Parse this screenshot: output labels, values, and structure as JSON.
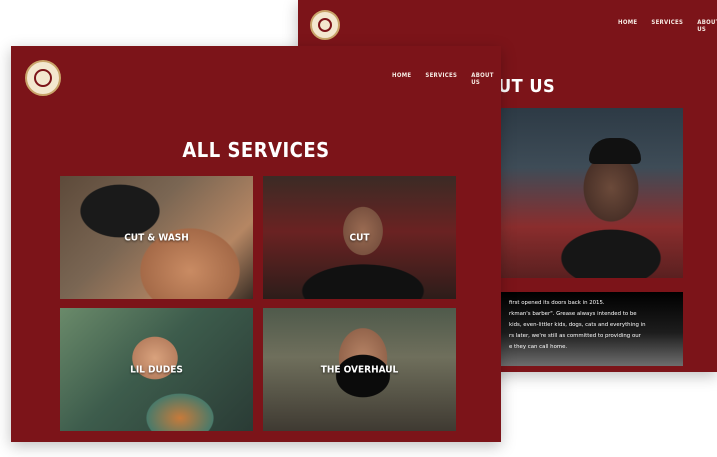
{
  "back_page": {
    "nav": [
      "HOME",
      "SERVICES",
      "ABOUT US"
    ],
    "title": "UT US",
    "about_text": [
      "first opened its doors back in 2015.",
      "rkman's barber\". Grease always intended to be",
      "kids, even-littler kids, dogs, cats and everything in",
      "rs later, we're still as committed to providing our",
      "e they can call home."
    ]
  },
  "front_page": {
    "nav": [
      "HOME",
      "SERVICES",
      "ABOUT US"
    ],
    "title": "ALL SERVICES",
    "services": [
      {
        "label": "CUT & WASH"
      },
      {
        "label": "CUT"
      },
      {
        "label": "LIL DUDES"
      },
      {
        "label": "THE OVERHAUL"
      }
    ]
  },
  "colors": {
    "brand": "#7c1419",
    "logo": "#f3e7cf"
  }
}
